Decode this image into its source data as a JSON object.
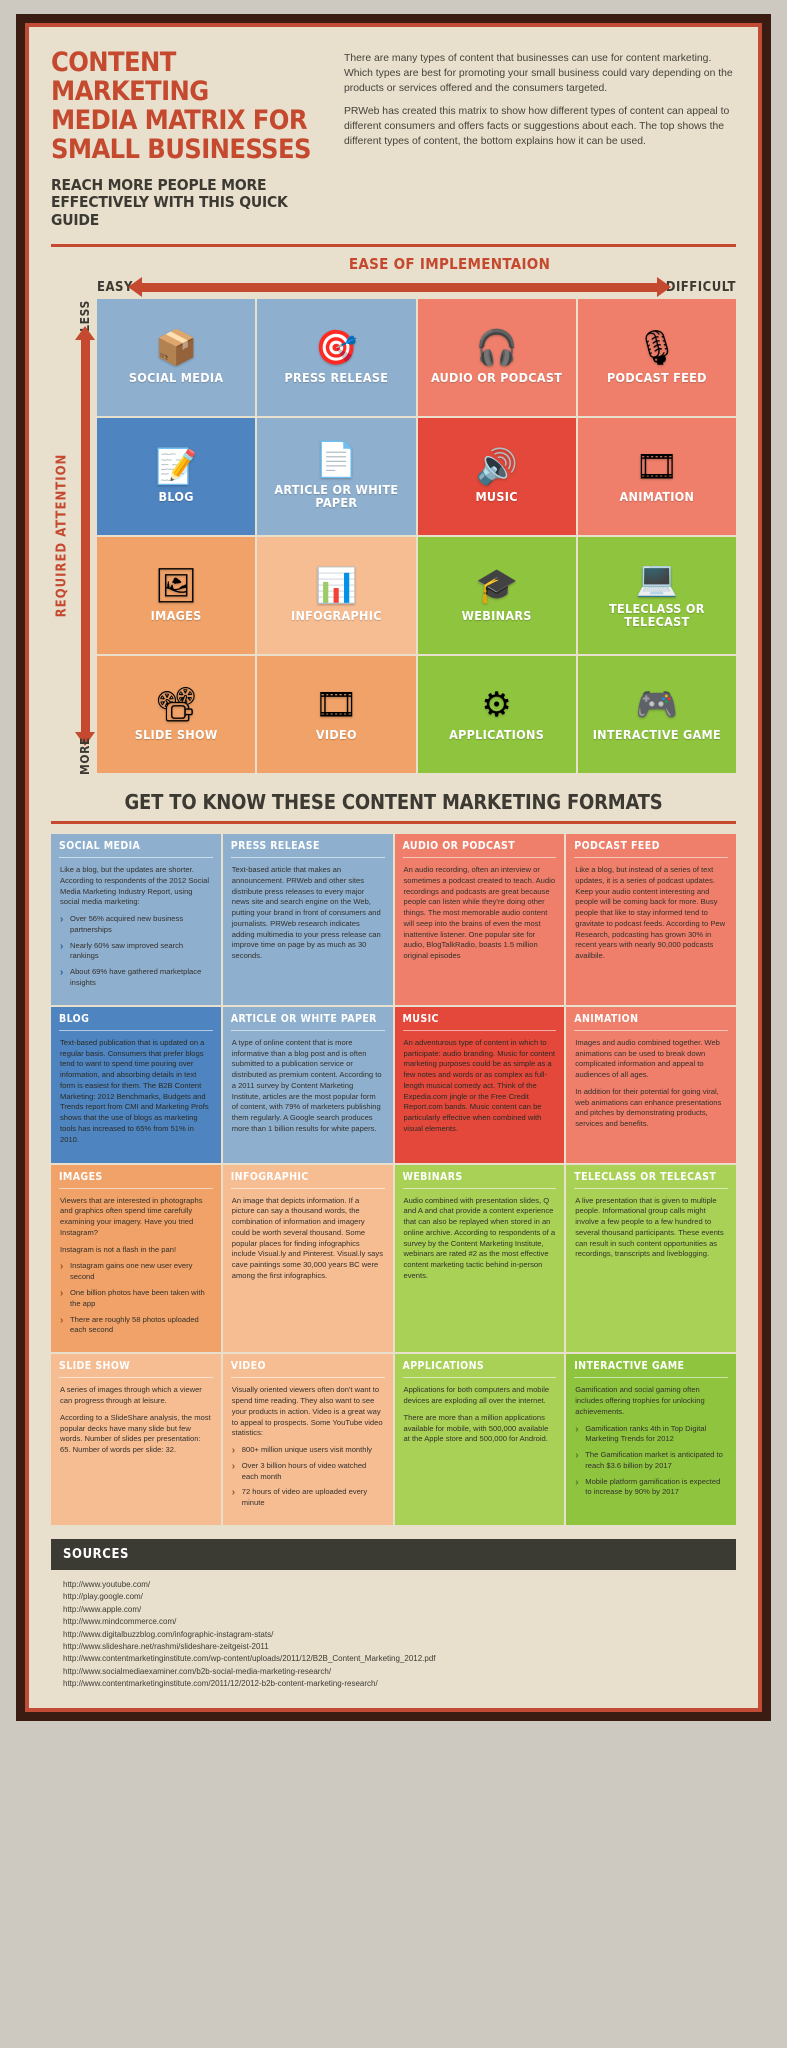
{
  "header": {
    "title_lines": [
      "CONTENT MARKETING",
      "MEDIA MATRIX FOR",
      "SMALL BUSINESSES"
    ],
    "subtitle_lines": [
      "REACH MORE PEOPLE MORE",
      "EFFECTIVELY WITH THIS QUICK GUIDE"
    ],
    "intro_p1": "There are many types of content that businesses can use for content marketing. Which types are best for promoting your small business could vary depending on the products or services offered and the consumers targeted.",
    "intro_p2": "PRWeb has created this matrix to show how different types of content can appeal to different consumers and offers facts or suggestions about each. The top shows the different types of content, the bottom explains how it can be used."
  },
  "matrix": {
    "x_axis_title": "EASE OF IMPLEMENTAION",
    "x_axis_left": "EASY",
    "x_axis_right": "DIFFICULT",
    "y_axis_title": "REQUIRED ATTENTION",
    "y_axis_top": "LESS",
    "y_axis_bottom": "MORE",
    "cells": [
      {
        "label": "SOCIAL MEDIA",
        "icon": "social-media-box-icon",
        "glyph": "📦",
        "color": "#8fafce"
      },
      {
        "label": "PRESS RELEASE",
        "icon": "press-release-target-icon",
        "glyph": "🎯",
        "color": "#8fafce"
      },
      {
        "label": "AUDIO OR PODCAST",
        "icon": "headphones-icon",
        "glyph": "🎧",
        "color": "#ef7f6b"
      },
      {
        "label": "PODCAST FEED",
        "icon": "microphone-icon",
        "glyph": "🎙",
        "color": "#ef7f6b"
      },
      {
        "label": "BLOG",
        "icon": "document-pencil-icon",
        "glyph": "📝",
        "color": "#4e84bf"
      },
      {
        "label": "ARTICLE OR WHITE PAPER",
        "icon": "article-quill-icon",
        "glyph": "📄",
        "color": "#8fafce"
      },
      {
        "label": "MUSIC",
        "icon": "speaker-icon",
        "glyph": "🔊",
        "color": "#e3483a"
      },
      {
        "label": "ANIMATION",
        "icon": "animation-frames-icon",
        "glyph": "🎞",
        "color": "#ef7f6b"
      },
      {
        "label": "IMAGES",
        "icon": "photos-icon",
        "glyph": "🖼",
        "color": "#f0a268"
      },
      {
        "label": "INFOGRAPHIC",
        "icon": "infographic-chart-icon",
        "glyph": "📊",
        "color": "#f6bd93"
      },
      {
        "label": "WEBINARS",
        "icon": "graduate-icon",
        "glyph": "🎓",
        "color": "#8fc43f"
      },
      {
        "label": "TELECLASS OR TELECAST",
        "icon": "monitor-icon",
        "glyph": "💻",
        "color": "#8fc43f"
      },
      {
        "label": "SLIDE SHOW",
        "icon": "projector-icon",
        "glyph": "📽",
        "color": "#f0a268"
      },
      {
        "label": "VIDEO",
        "icon": "film-reel-icon",
        "glyph": "🎞",
        "color": "#f0a268"
      },
      {
        "label": "APPLICATIONS",
        "icon": "gear-icon",
        "glyph": "⚙",
        "color": "#8fc43f"
      },
      {
        "label": "INTERACTIVE GAME",
        "icon": "gamepad-icon",
        "glyph": "🎮",
        "color": "#8fc43f"
      }
    ]
  },
  "formats": {
    "section_title": "GET TO KNOW THESE CONTENT MARKETING FORMATS",
    "cards": [
      {
        "title": "SOCIAL MEDIA",
        "theme": "c-lightblue",
        "paragraphs": [
          "Like a blog, but the updates are shorter. According to respondents of the 2012 Social Media Marketing Industry Report, using social media marketing:"
        ],
        "bullets": [
          "Over 56% acquired new business partnerships",
          "Nearly 60% saw improved search rankings",
          "About 69% have gathered marketplace insights"
        ]
      },
      {
        "title": "PRESS RELEASE",
        "theme": "c-lightblue",
        "paragraphs": [
          "Text-based article that makes an announcement. PRWeb and other sites distribute press releases to every major news site and search engine on the Web, putting your brand in front of consumers and journalists. PRWeb research indicates adding multimedia to your press release can improve time on page by as much as 30 seconds."
        ],
        "bullets": []
      },
      {
        "title": "AUDIO OR PODCAST",
        "theme": "c-salmon",
        "paragraphs": [
          "An audio recording, often an interview or sometimes a podcast created to teach. Audio recordings and podcasts are great because people can listen while they're doing other things. The most memorable audio content will seep into the brains of even the most inattentive listener. One popular site for audio, BlogTalkRadio, boasts 1.5 million original episodes"
        ],
        "bullets": []
      },
      {
        "title": "PODCAST FEED",
        "theme": "c-salmon",
        "paragraphs": [
          "Like a blog, but instead of a series of text updates, it is a series of podcast updates. Keep your audio content interesting and people will be coming back for more. Busy people that like to stay informed tend to gravitate to podcast feeds. According to Pew Research, podcasting has grown 30% in recent years with nearly 90,000 podcasts availbile."
        ],
        "bullets": []
      },
      {
        "title": "BLOG",
        "theme": "c-blue",
        "paragraphs": [
          "Text-based publication that is updated on a regular basis. Consumers that prefer blogs tend to want to spend time pouring over information, and absorbing details in text form is easiest for them. The B2B Content Marketing: 2012 Benchmarks, Budgets and Trends report from CMI and Marketing Profs shows that the use of blogs as marketing tools has increased to 65% from 51% in 2010."
        ],
        "bullets": []
      },
      {
        "title": "ARTICLE OR WHITE PAPER",
        "theme": "c-lightblue",
        "paragraphs": [
          "A type of online content that is more informative than a blog post and is often submitted to a publication service or distributed as premium content. According to a 2011 survey by Content Marketing Institute, articles are the most popular form of content, with 79% of marketers publishing them regularly. A Google search produces more than 1 billion results for white papers."
        ],
        "bullets": []
      },
      {
        "title": "MUSIC",
        "theme": "c-red",
        "paragraphs": [
          "An adventurous type of content in which to participate: audio branding. Music for content marketing purposes could be as simple as a few notes and words or as complex as full-length musical comedy act. Think of the Expedia.com jingle or the Free Credit Report.com bands. Music content can be particularly effective when combined with visual elements."
        ],
        "bullets": []
      },
      {
        "title": "ANIMATION",
        "theme": "c-salmon",
        "paragraphs": [
          "Images and audio combined together. Web animations can be used to break down complicated information and appeal to audiences of all ages.",
          "In addition for their potential for going viral, web animations can enhance presentations and pitches by demonstrating products, services and benefits."
        ],
        "bullets": []
      },
      {
        "title": "IMAGES",
        "theme": "c-orange",
        "paragraphs": [
          "Viewers that are interested in photographs and graphics often spend time carefully examining your imagery. Have you tried Instagram?",
          "Instagram is not a flash in the pan!"
        ],
        "bullets": [
          "Instagram gains one new user every second",
          "One billion photos have been taken with the app",
          "There are roughly 58 photos uploaded each second"
        ]
      },
      {
        "title": "INFOGRAPHIC",
        "theme": "c-lightorange",
        "paragraphs": [
          "An image that depicts information. If a picture can say a thousand words, the combination of information and imagery could be worth several thousand. Some popular places for finding infographics include Visual.ly and Pinterest.  Visual.ly says cave paintings some 30,000 years BC were among the first infographics."
        ],
        "bullets": []
      },
      {
        "title": "WEBINARS",
        "theme": "c-lightgreen",
        "paragraphs": [
          "Audio combined with presentation slides, Q and A and chat provide a content experience that can also be replayed when stored in an online archive. According to respondents of a survey by the Content Marketing Institute, webinars are rated #2 as the most effective content marketing tactic behind in-person events."
        ],
        "bullets": []
      },
      {
        "title": "TELECLASS OR TELECAST",
        "theme": "c-lightgreen",
        "paragraphs": [
          "A live presentation that is given to multiple people.  Informational group calls might involve a few people to a few hundred to several thousand participants. These events can result in such content opportunities as recordings, transcripts and liveblogging."
        ],
        "bullets": []
      },
      {
        "title": "SLIDE SHOW",
        "theme": "c-lightorange",
        "paragraphs": [
          "A series of images through which a viewer can progress through at leisure.",
          "According to a SlideShare analysis, the most popular decks have many slide but few words. Number of slides per presentation: 65. Number of words per slide: 32."
        ],
        "bullets": []
      },
      {
        "title": "VIDEO",
        "theme": "c-lightorange",
        "paragraphs": [
          "Visually oriented viewers often don't want to spend time reading. They also want to see your products in action. Video is a great way to appeal to prospects. Some YouTube video statistics:"
        ],
        "bullets": [
          "800+ million unique users visit monthly",
          "Over 3 billion hours of video watched each month",
          "72 hours of video are uploaded every minute"
        ]
      },
      {
        "title": "APPLICATIONS",
        "theme": "c-lightgreen",
        "paragraphs": [
          "Applications for both computers and mobile devices are exploding all over the internet.",
          "There are more than a million applications available for mobile, with 500,000 available at the Apple store and 500,000 for Android."
        ],
        "bullets": []
      },
      {
        "title": "INTERACTIVE GAME",
        "theme": "c-green",
        "paragraphs": [
          "Gamification and social gaming often includes offering trophies for unlocking achievements."
        ],
        "bullets": [
          "Gamification ranks 4th in Top Digital Marketing Trends for 2012",
          "The Gamification market is anticipated to reach $3.6 billion by 2017",
          "Mobile platform gamification is expected to increase by 90% by 2017"
        ]
      }
    ]
  },
  "sources": {
    "title": "SOURCES",
    "urls": [
      "http://www.youtube.com/",
      "http://play.google.com/",
      "http://www.apple.com/",
      "http://www.mindcommerce.com/",
      "http://www.digitalbuzzblog.com/infographic-instagram-stats/",
      "http://www.slideshare.net/rashmi/slideshare-zeitgeist-2011",
      "http://www.contentmarketinginstitute.com/wp-content/uploads/2011/12/B2B_Content_Marketing_2012.pdf",
      "http://www.socialmediaexaminer.com/b2b-social-media-marketing-research/",
      "http://www.contentmarketinginstitute.com/2011/12/2012-b2b-content-marketing-research/"
    ]
  },
  "colors": {
    "brand_red": "#c4492f",
    "paper": "#e8e0cd",
    "dark_frame": "#3b1c12",
    "text_dark": "#3d3a33"
  }
}
